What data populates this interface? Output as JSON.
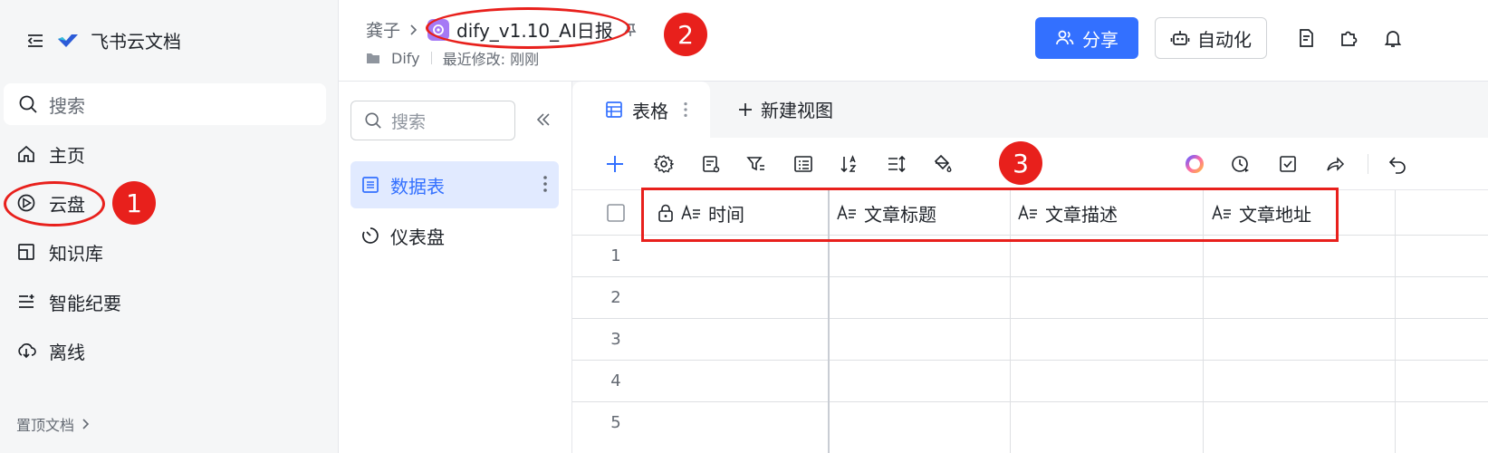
{
  "app": {
    "name": "飞书云文档"
  },
  "sidebar": {
    "search_placeholder": "搜索",
    "items": [
      {
        "label": "主页",
        "icon": "home-icon"
      },
      {
        "label": "云盘",
        "icon": "cloud-drive-icon"
      },
      {
        "label": "知识库",
        "icon": "wiki-icon"
      },
      {
        "label": "智能纪要",
        "icon": "minutes-icon"
      },
      {
        "label": "离线",
        "icon": "offline-icon"
      }
    ],
    "pinned_label": "置顶文档"
  },
  "header": {
    "breadcrumb_parent": "龚子",
    "doc_title": "dify_v1.10_AI日报",
    "folder": "Dify",
    "last_modified": "最近修改: 刚刚",
    "share_label": "分享",
    "automation_label": "自动化"
  },
  "left_panel": {
    "search_placeholder": "搜索",
    "items": [
      {
        "label": "数据表",
        "active": true
      },
      {
        "label": "仪表盘",
        "active": false
      }
    ]
  },
  "view": {
    "active_tab": "表格",
    "new_view_label": "新建视图"
  },
  "table": {
    "columns": [
      "时间",
      "文章标题",
      "文章描述",
      "文章地址"
    ],
    "row_numbers": [
      "1",
      "2",
      "3",
      "4",
      "5"
    ]
  },
  "annotations": {
    "badge1": "1",
    "badge2": "2",
    "badge3": "3"
  },
  "colors": {
    "accent": "#3370ff",
    "annotation": "#e8201c"
  }
}
